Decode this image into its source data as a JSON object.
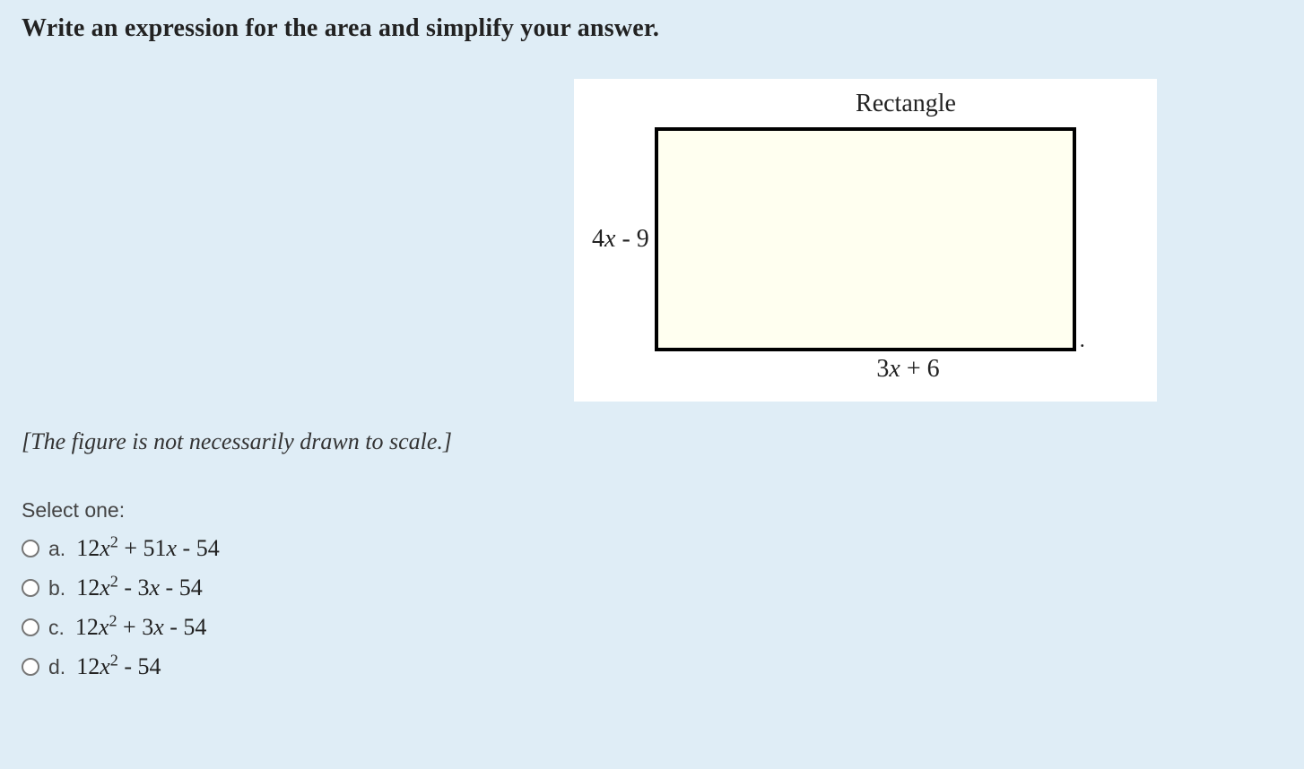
{
  "question": {
    "prompt": "Write an expression for the area and simplify your answer.",
    "scale_note": "[The figure is not necessarily drawn to scale.]",
    "select_label": "Select one:"
  },
  "figure": {
    "title": "Rectangle",
    "height_label_prefix": "4",
    "height_label_var": "x",
    "height_label_suffix": " - 9",
    "width_label_prefix": "3",
    "width_label_var": "x",
    "width_label_suffix": " + 6"
  },
  "options": [
    {
      "letter": "a.",
      "c1": "12",
      "v1": "x",
      "sup": "2",
      "mid": " + 51",
      "v2": "x",
      "tail": " - 54"
    },
    {
      "letter": "b.",
      "c1": "12",
      "v1": "x",
      "sup": "2",
      "mid": " - 3",
      "v2": "x",
      "tail": " - 54"
    },
    {
      "letter": "c.",
      "c1": "12",
      "v1": "x",
      "sup": "2",
      "mid": " + 3",
      "v2": "x",
      "tail": " - 54"
    },
    {
      "letter": "d.",
      "c1": "12",
      "v1": "x",
      "sup": "2",
      "mid": "",
      "v2": "",
      "tail": " - 54"
    }
  ]
}
